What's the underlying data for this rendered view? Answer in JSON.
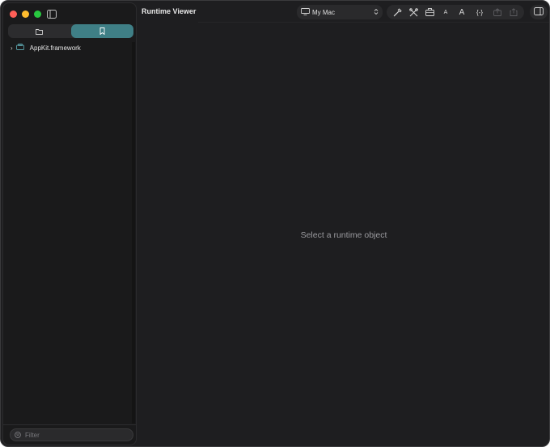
{
  "window": {
    "title": "Runtime Viewer",
    "traffic_lights": {
      "close": "#ff5f57",
      "minimize": "#febc2e",
      "zoom": "#28c840"
    }
  },
  "sidebar": {
    "toggle_icon": "sidebar-left-icon",
    "tabs": [
      {
        "icon": "folder-icon",
        "active": false
      },
      {
        "icon": "bookmark-icon",
        "active": true
      }
    ],
    "tree": [
      {
        "label": "AppKit.framework",
        "icon": "framework-icon",
        "expanded": false
      }
    ],
    "filter": {
      "placeholder": "Filter",
      "value": ""
    }
  },
  "toolbar": {
    "device": {
      "label": "My Mac",
      "icon": "display-icon"
    },
    "tools": [
      {
        "name": "eyedropper-icon"
      },
      {
        "name": "tools-icon"
      },
      {
        "name": "briefcase-icon"
      },
      {
        "name": "text-smaller-icon",
        "label": "A"
      },
      {
        "name": "text-larger-icon",
        "label": "A"
      },
      {
        "name": "braces-icon",
        "label": "{-}"
      },
      {
        "name": "export-icon",
        "disabled": true
      },
      {
        "name": "share-icon",
        "disabled": true
      }
    ],
    "inspector_icon": "sidebar-right-icon"
  },
  "main": {
    "empty_message": "Select a runtime object"
  },
  "colors": {
    "accent": "#3f7f86",
    "background": "#1e1e20",
    "sidebar": "#1a1a1b"
  }
}
